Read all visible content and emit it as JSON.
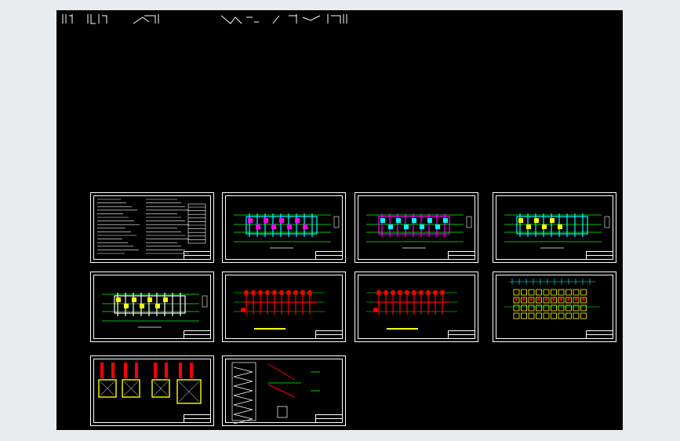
{
  "viewer": {
    "background": "#e9ecef",
    "canvas_color": "#000000"
  },
  "colors": {
    "frame": "#ffffff",
    "cyan": "#00ffff",
    "green": "#00ff00",
    "yellow": "#ffff00",
    "red": "#ff0000",
    "magenta": "#ff00ff"
  },
  "sheets": [
    {
      "id": "general-notes",
      "kind": "notes"
    },
    {
      "id": "plan-1",
      "kind": "plan-cyan"
    },
    {
      "id": "plan-2",
      "kind": "plan-magenta"
    },
    {
      "id": "plan-3",
      "kind": "plan-yellow"
    },
    {
      "id": "plan-4",
      "kind": "plan-yellow-small"
    },
    {
      "id": "plan-5",
      "kind": "plan-red"
    },
    {
      "id": "plan-6",
      "kind": "plan-red"
    },
    {
      "id": "plan-7",
      "kind": "plan-grid"
    },
    {
      "id": "foundation-details",
      "kind": "details"
    },
    {
      "id": "stair-details",
      "kind": "stairs"
    }
  ]
}
